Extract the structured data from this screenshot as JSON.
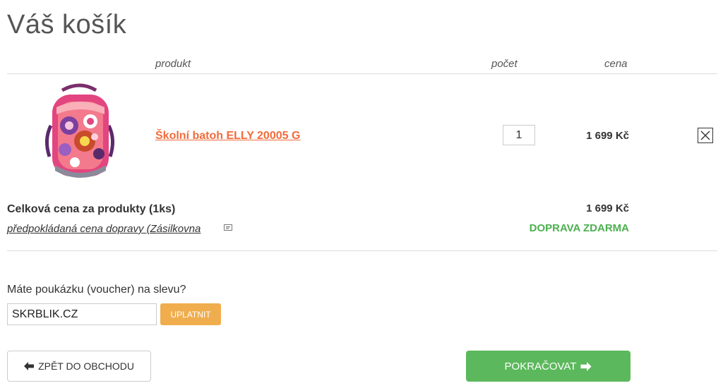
{
  "page": {
    "title": "Váš košík"
  },
  "columns": {
    "product": "produkt",
    "quantity": "počet",
    "price": "cena"
  },
  "cart": {
    "items": [
      {
        "name": "Školní batoh ELLY 20005 G",
        "quantity": "1",
        "price": "1 699 Kč"
      }
    ]
  },
  "summary": {
    "total_label": "Celková cena za produkty (1ks)",
    "total_value": "1 699 Kč",
    "shipping_label": "předpokládaná cena dopravy (Zásilkovna",
    "shipping_value": "DOPRAVA ZDARMA"
  },
  "voucher": {
    "label": "Máte poukázku (voucher) na slevu?",
    "value": "SKRBLIK.CZ",
    "apply_label": "UPLATNIT"
  },
  "actions": {
    "back_label": "ZPĚT DO OBCHODU",
    "continue_label": "POKRAČOVAT"
  },
  "colors": {
    "accent_orange": "#f26b3a",
    "green": "#5cb85c",
    "free_shipping_green": "#4caf50",
    "apply_button": "#f0ad4e"
  },
  "icons": [
    "close-icon",
    "arrow-left-icon",
    "arrow-right-icon",
    "info-icon"
  ]
}
